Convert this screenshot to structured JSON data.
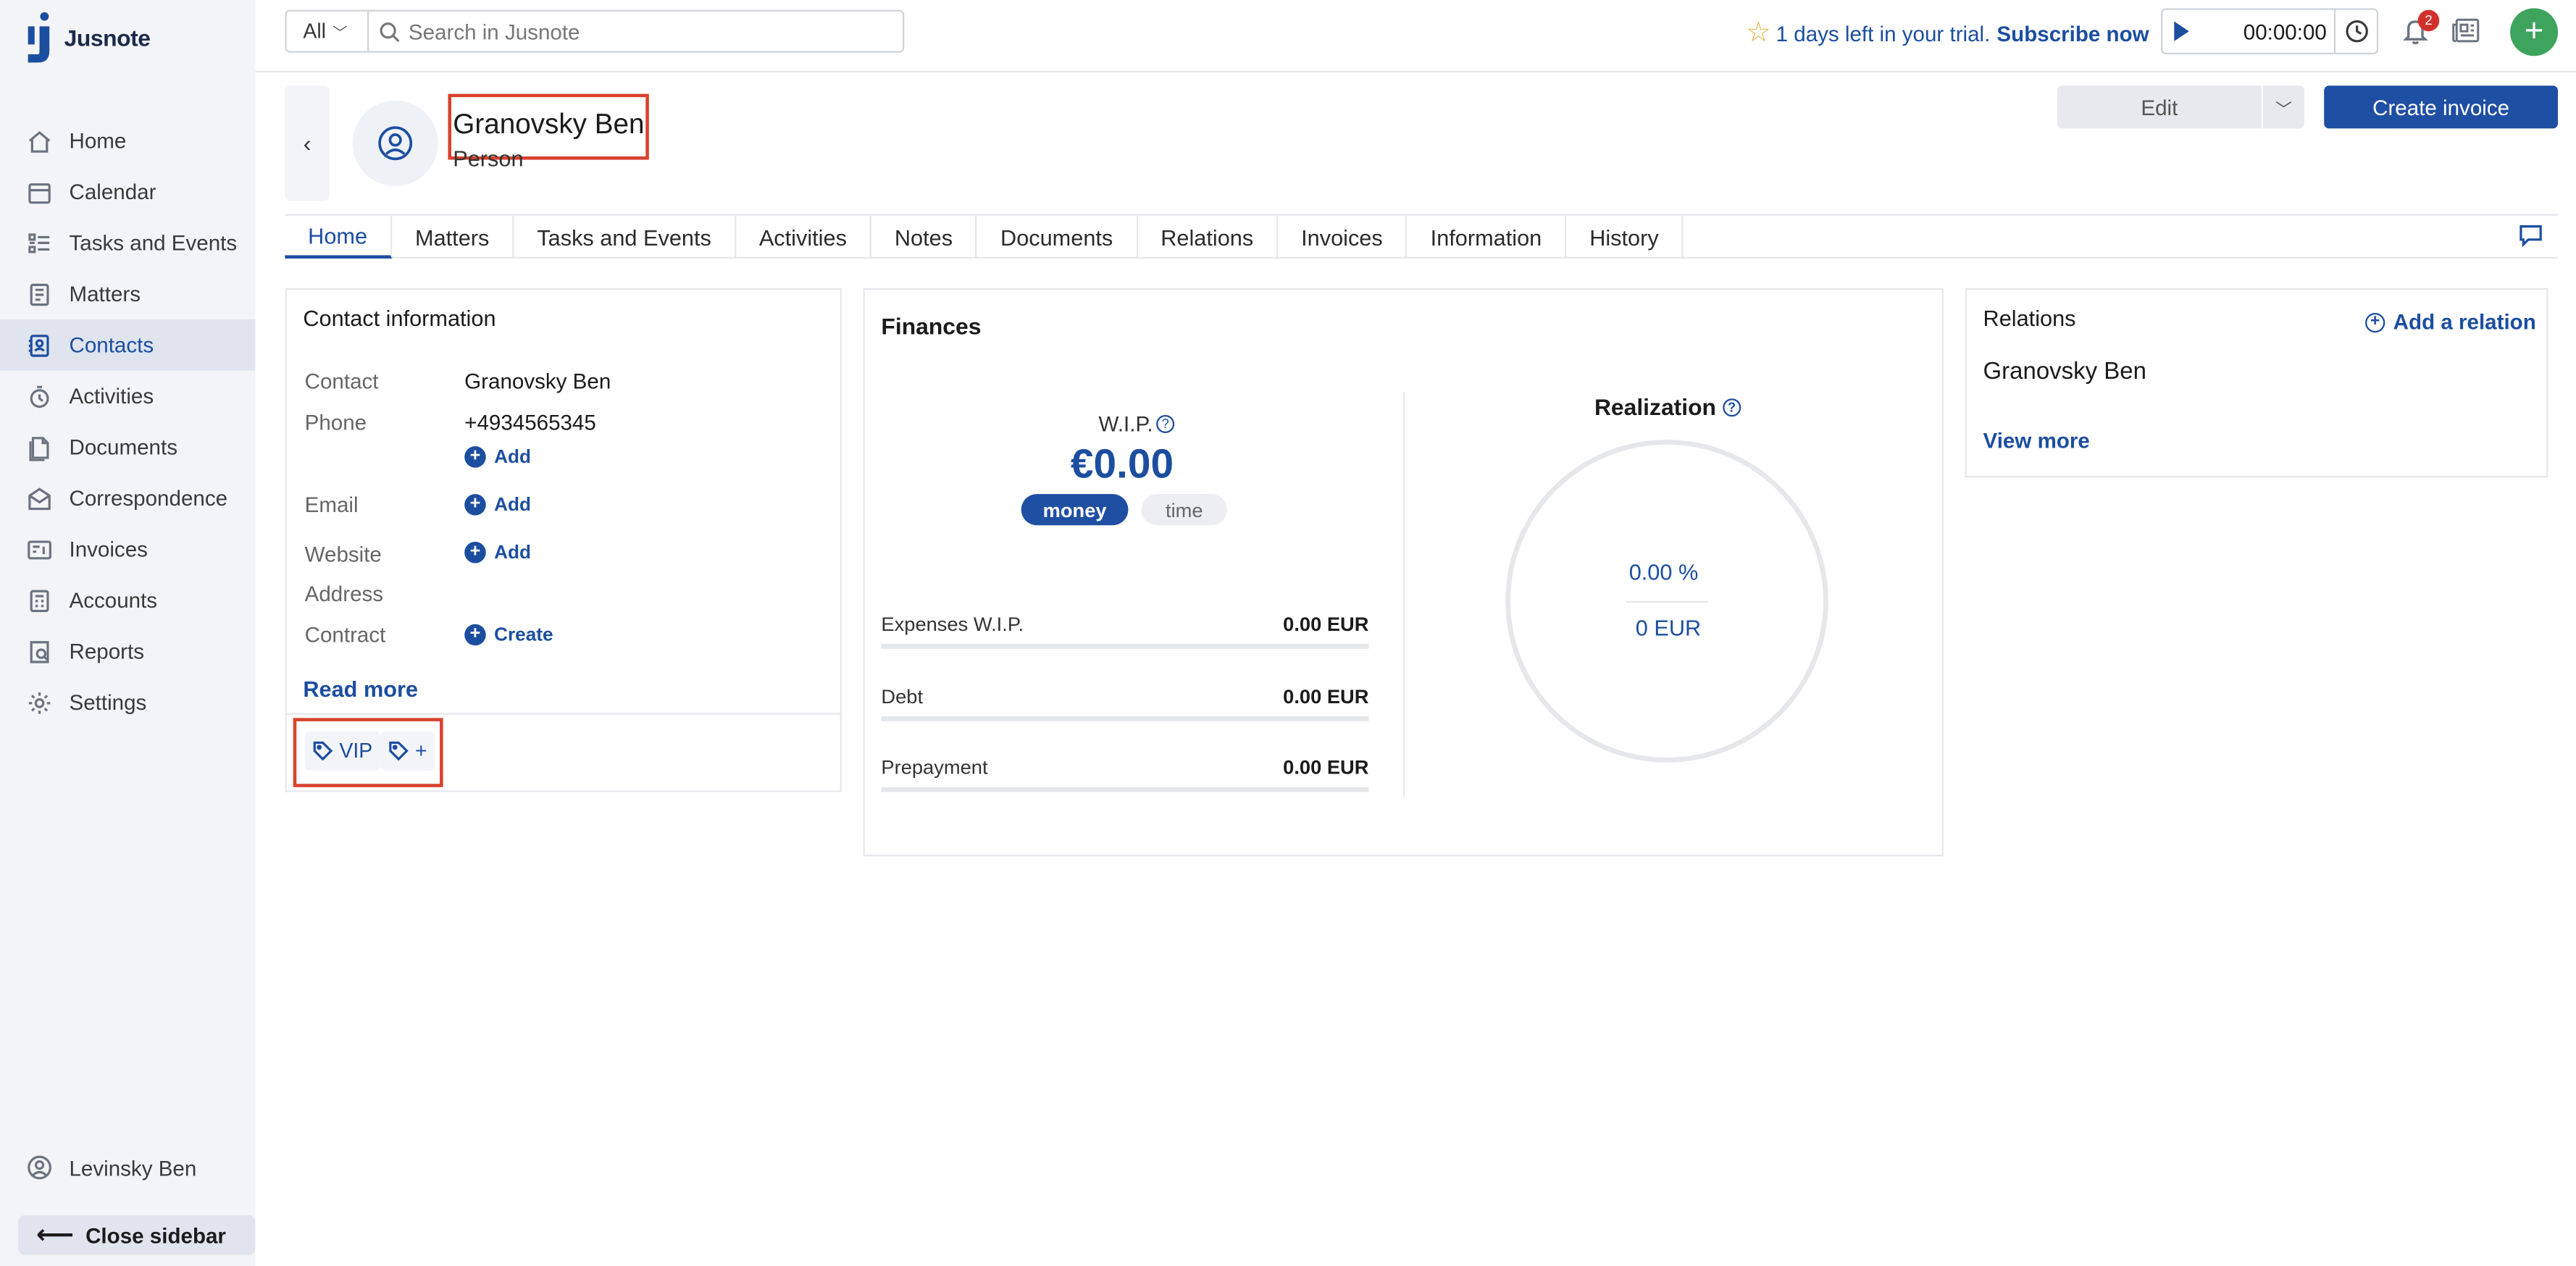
{
  "app": {
    "name": "Jusnote"
  },
  "sidebar": {
    "items": [
      {
        "label": "Home",
        "icon": "home-icon"
      },
      {
        "label": "Calendar",
        "icon": "calendar-icon"
      },
      {
        "label": "Tasks and Events",
        "icon": "tasks-icon"
      },
      {
        "label": "Matters",
        "icon": "matters-icon"
      },
      {
        "label": "Contacts",
        "icon": "contacts-icon",
        "active": true
      },
      {
        "label": "Activities",
        "icon": "activities-icon"
      },
      {
        "label": "Documents",
        "icon": "documents-icon"
      },
      {
        "label": "Correspondence",
        "icon": "correspondence-icon"
      },
      {
        "label": "Invoices",
        "icon": "invoices-icon"
      },
      {
        "label": "Accounts",
        "icon": "accounts-icon"
      },
      {
        "label": "Reports",
        "icon": "reports-icon"
      },
      {
        "label": "Settings",
        "icon": "gear-icon"
      }
    ],
    "user": "Levinsky Ben",
    "close_label": "Close sidebar"
  },
  "topbar": {
    "scope": "All",
    "search_placeholder": "Search in Jusnote",
    "trial_text": "1 days left in your trial.",
    "subscribe": "Subscribe now",
    "timer": "00:00:00",
    "notifications": "2"
  },
  "header": {
    "name": "Granovsky Ben",
    "type": "Person",
    "edit_label": "Edit",
    "invoice_label": "Create invoice"
  },
  "tabs": [
    "Home",
    "Matters",
    "Tasks and Events",
    "Activities",
    "Notes",
    "Documents",
    "Relations",
    "Invoices",
    "Information",
    "History"
  ],
  "contact": {
    "title": "Contact information",
    "contact_label": "Contact",
    "contact_value": "Granovsky Ben",
    "phone_label": "Phone",
    "phone_value": "+4934565345",
    "email_label": "Email",
    "website_label": "Website",
    "address_label": "Address",
    "contract_label": "Contract",
    "add": "Add",
    "create": "Create",
    "read_more": "Read more",
    "tags": [
      "VIP",
      "+"
    ]
  },
  "finances": {
    "title": "Finances",
    "wip_label": "W.I.P.",
    "wip_value": "€0.00",
    "toggle_on": "money",
    "toggle_off": "time",
    "rows": [
      {
        "label": "Expenses W.I.P.",
        "amount": "0.00 EUR"
      },
      {
        "label": "Debt",
        "amount": "0.00 EUR"
      },
      {
        "label": "Prepayment",
        "amount": "0.00 EUR"
      }
    ],
    "realization_title": "Realization",
    "realization_pct": "0.00 %",
    "realization_eur": "0 EUR"
  },
  "relations": {
    "title": "Relations",
    "add": "Add a relation",
    "name": "Granovsky Ben",
    "view_more": "View more"
  }
}
